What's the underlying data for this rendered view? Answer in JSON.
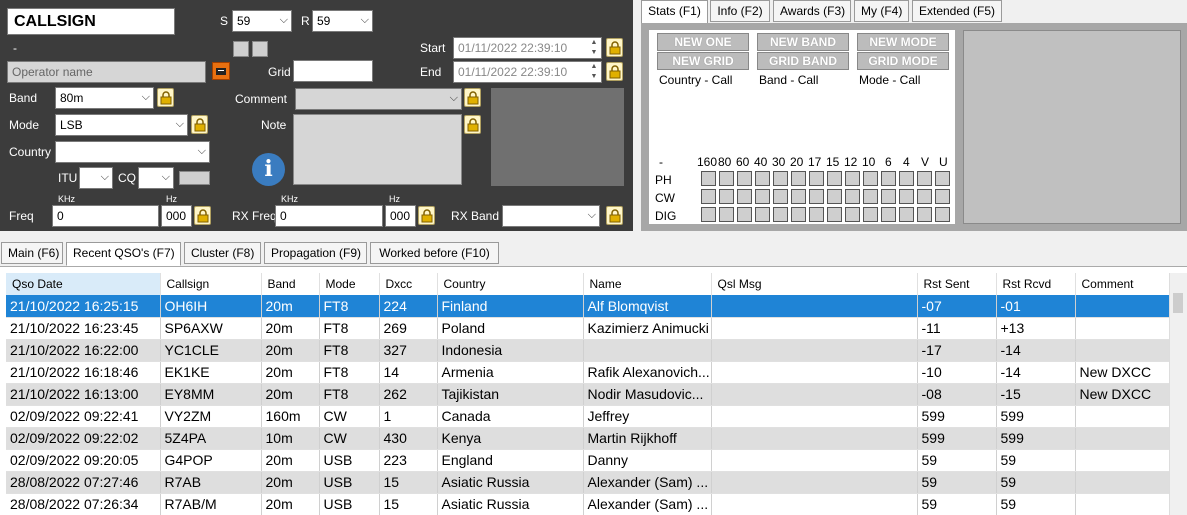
{
  "entry": {
    "callsign": "CALLSIGN",
    "dash": "-",
    "s_label": "S",
    "s_value": "59",
    "r_label": "R",
    "r_value": "59",
    "start_label": "Start",
    "start_value": "01/11/2022 22:39:10",
    "end_label": "End",
    "end_value": "01/11/2022 22:39:10",
    "operator_placeholder": "Operator name",
    "grid_label": "Grid",
    "band_label": "Band",
    "band_value": "80m",
    "comment_label": "Comment",
    "mode_label": "Mode",
    "mode_value": "LSB",
    "note_label": "Note",
    "country_label": "Country",
    "itu_label": "ITU",
    "cq_label": "CQ",
    "freq_label": "Freq",
    "khz_label": "KHz",
    "hz_label": "Hz",
    "freq_khz": "0",
    "freq_hz": "000",
    "rxfreq_label": "RX Freq",
    "rx_khz": "0",
    "rx_hz": "000",
    "rxband_label": "RX Band"
  },
  "stats_tabs": [
    "Stats (F1)",
    "Info (F2)",
    "Awards (F3)",
    "My (F4)",
    "Extended (F5)"
  ],
  "stats": {
    "buttons": [
      "NEW ONE",
      "NEW BAND",
      "NEW MODE",
      "NEW GRID",
      "GRID BAND",
      "GRID MODE"
    ],
    "captions": [
      "Country - Call",
      "Band - Call",
      "Mode - Call"
    ],
    "band_header_dash": "-",
    "bands": [
      "160",
      "80",
      "60",
      "40",
      "30",
      "20",
      "17",
      "15",
      "12",
      "10",
      "6",
      "4",
      "V",
      "U"
    ],
    "rows": [
      "PH",
      "CW",
      "DIG"
    ]
  },
  "main_tabs": [
    "Main (F6)",
    "Recent QSO's (F7)",
    "Cluster (F8)",
    "Propagation (F9)",
    "Worked before (F10)"
  ],
  "table": {
    "headers": [
      "Qso Date",
      "Callsign",
      "Band",
      "Mode",
      "Dxcc",
      "Country",
      "Name",
      "Qsl Msg",
      "Rst Sent",
      "Rst Rcvd",
      "Comment"
    ],
    "rows": [
      [
        "21/10/2022 16:25:15",
        "OH6IH",
        "20m",
        "FT8",
        "224",
        "Finland",
        "Alf Blomqvist",
        "",
        "-07",
        "-01",
        ""
      ],
      [
        "21/10/2022 16:23:45",
        "SP6AXW",
        "20m",
        "FT8",
        "269",
        "Poland",
        "Kazimierz Animucki",
        "",
        "-11",
        "+13",
        ""
      ],
      [
        "21/10/2022 16:22:00",
        "YC1CLE",
        "20m",
        "FT8",
        "327",
        "Indonesia",
        "",
        "",
        "-17",
        "-14",
        ""
      ],
      [
        "21/10/2022 16:18:46",
        "EK1KE",
        "20m",
        "FT8",
        "14",
        "Armenia",
        "Rafik Alexanovich...",
        "",
        "-10",
        "-14",
        "New DXCC"
      ],
      [
        "21/10/2022 16:13:00",
        "EY8MM",
        "20m",
        "FT8",
        "262",
        "Tajikistan",
        "Nodir Masudovic...",
        "",
        "-08",
        "-15",
        "New DXCC"
      ],
      [
        "02/09/2022 09:22:41",
        "VY2ZM",
        "160m",
        "CW",
        "1",
        "Canada",
        "Jeffrey",
        "",
        "599",
        "599",
        ""
      ],
      [
        "02/09/2022 09:22:02",
        "5Z4PA",
        "10m",
        "CW",
        "430",
        "Kenya",
        "Martin Rijkhoff",
        "",
        "599",
        "599",
        ""
      ],
      [
        "02/09/2022 09:20:05",
        "G4POP",
        "20m",
        "USB",
        "223",
        "England",
        "Danny",
        "",
        "59",
        "59",
        ""
      ],
      [
        "28/08/2022 07:27:46",
        "R7AB",
        "20m",
        "USB",
        "15",
        "Asiatic Russia",
        "Alexander (Sam) ...",
        "",
        "59",
        "59",
        ""
      ],
      [
        "28/08/2022 07:26:34",
        "R7AB/M",
        "20m",
        "USB",
        "15",
        "Asiatic Russia",
        "Alexander (Sam) ...",
        "",
        "59",
        "59",
        ""
      ]
    ]
  },
  "colors": {
    "panel": "#3c3c3c",
    "selected_row": "#1f84d6"
  }
}
